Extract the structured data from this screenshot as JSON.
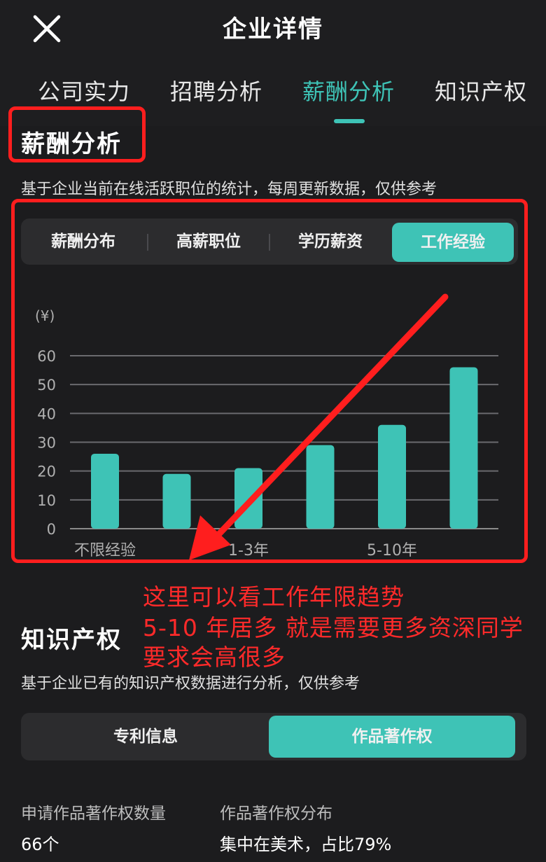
{
  "header": {
    "title": "企业详情",
    "close_icon": "close-icon"
  },
  "tabs": [
    {
      "label": "公司实力",
      "active": false
    },
    {
      "label": "招聘分析",
      "active": false
    },
    {
      "label": "薪酬分析",
      "active": true
    },
    {
      "label": "知识产权",
      "active": false
    }
  ],
  "salary_section": {
    "title": "薪酬分析",
    "description": "基于企业当前在线活跃职位的统计，每周更新数据，仅供参考",
    "subtabs": [
      {
        "label": "薪酬分布",
        "active": false
      },
      {
        "label": "高薪职位",
        "active": false
      },
      {
        "label": "学历薪资",
        "active": false
      },
      {
        "label": "工作经验",
        "active": true
      }
    ]
  },
  "chart_data": {
    "type": "bar",
    "ylabel": "(¥)",
    "ylim": [
      0,
      60
    ],
    "yticks": [
      "0",
      "10",
      "20",
      "30",
      "40",
      "50",
      "60"
    ],
    "categories": [
      "不限经验",
      "",
      "1-3年",
      "",
      "5-10年",
      ""
    ],
    "values": [
      26,
      19,
      21,
      29,
      36,
      56
    ],
    "grid": true,
    "bar_color": "#3ec3b6"
  },
  "annotation": {
    "lines": [
      "这里可以看工作年限趋势",
      "5-10 年居多 就是需要更多资深同学",
      "要求会高很多"
    ],
    "color": "#ff2a2a"
  },
  "ip_section": {
    "title": "知识产权",
    "description": "基于企业已有的知识产权数据进行分析，仅供参考",
    "toggle": [
      {
        "label": "专利信息",
        "active": false
      },
      {
        "label": "作品著作权",
        "active": true
      }
    ],
    "stats": [
      {
        "label": "申请作品著作权数量",
        "value": "66个"
      },
      {
        "label": "作品著作权分布",
        "value": "集中在美术，占比79%"
      }
    ]
  },
  "colors": {
    "accent": "#3ec3b6",
    "highlight_box": "#ff1e1e",
    "background": "#1c1c1e"
  }
}
